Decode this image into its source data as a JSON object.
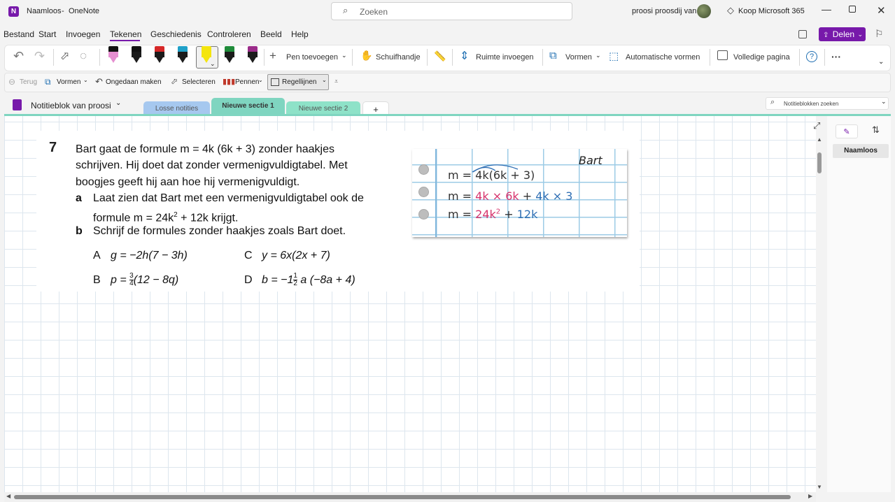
{
  "app": {
    "doc_title": "Naamloos",
    "separator": "-",
    "app_name": "OneNote",
    "logo_letter": "N"
  },
  "search": {
    "placeholder": "Zoeken"
  },
  "user": {
    "name": "proosi proosdij van"
  },
  "buy": {
    "label": "Koop Microsoft 365"
  },
  "menu": {
    "items": [
      "Bestand",
      "Start",
      "Invoegen",
      "Tekenen",
      "Geschiedenis",
      "Controleren",
      "Beeld",
      "Help"
    ],
    "active": "Tekenen"
  },
  "share": {
    "label": "Delen"
  },
  "ribbon": {
    "add_pen": "Pen toevoegen",
    "lasso": "Schuifhandje",
    "insert_space": "Ruimte invoegen",
    "shapes": "Vormen",
    "auto_shapes": "Automatische vormen",
    "full_page": "Volledige pagina",
    "help": "?",
    "more": "···"
  },
  "qat": {
    "back": "Terug",
    "shapes": "Vormen",
    "undo": "Ongedaan maken",
    "select": "Selecteren",
    "pens": "Pennen",
    "ruled": "Regellijnen"
  },
  "notebook": {
    "name": "Notitieblok van proosi"
  },
  "sections": [
    {
      "label": "Losse notities",
      "color": "#a6c8ef"
    },
    {
      "label": "Nieuwe sectie 1",
      "color": "#7fd5c0"
    },
    {
      "label": "Nieuwe sectie 2",
      "color": "#8ee2c8"
    }
  ],
  "add_section": "+",
  "nb_search": {
    "placeholder": "Notitieblokken zoeken"
  },
  "pages": {
    "items": [
      "Naamloos"
    ]
  },
  "exercise": {
    "number": "7",
    "intro_1": "Bart gaat de formule m = 4k (6k + 3) zonder haakjes",
    "intro_2": "schrijven. Hij doet dat zonder vermenigvuldigtabel. Met",
    "intro_3": "boogjes geeft hij aan hoe hij vermenigvuldigt.",
    "a_letter": "a",
    "a_text_1": "Laat zien dat Bart met een vermenigvuldigtabel ook de",
    "a_text_2a": "formule m = 24k",
    "a_text_2sup": "2",
    "a_text_2b": " + 12k krijgt.",
    "b_letter": "b",
    "b_text": "Schrijf de formules zonder haakjes zoals Bart doet.",
    "items": {
      "A": "g = −2h(7 − 3h)",
      "C": "y = 6x(2x + 7)",
      "B_pre": "p =",
      "B_num": "3",
      "B_den": "4",
      "B_post": "(12 − 8q)",
      "D_pre": "b = −1",
      "D_num": "1",
      "D_den": "2",
      "D_post": "a (−8a + 4)"
    },
    "letters": {
      "A": "A",
      "B": "B",
      "C": "C",
      "D": "D"
    }
  },
  "notebook_img": {
    "name": "Bart",
    "line1": "m = 4k(6k + 3)",
    "line2a": "m = ",
    "line2b": "4k × 6k",
    "line2c": " + ",
    "line2d": "4k × 3",
    "line3a": "m = ",
    "line3b": "24k",
    "line3sup": "2",
    "line3c": " + ",
    "line3d": "12k"
  },
  "colors": {
    "brand": "#7719aa",
    "accent_teal": "#7fd5c0",
    "pink": "#d6336c",
    "blue": "#2f6fb4"
  }
}
